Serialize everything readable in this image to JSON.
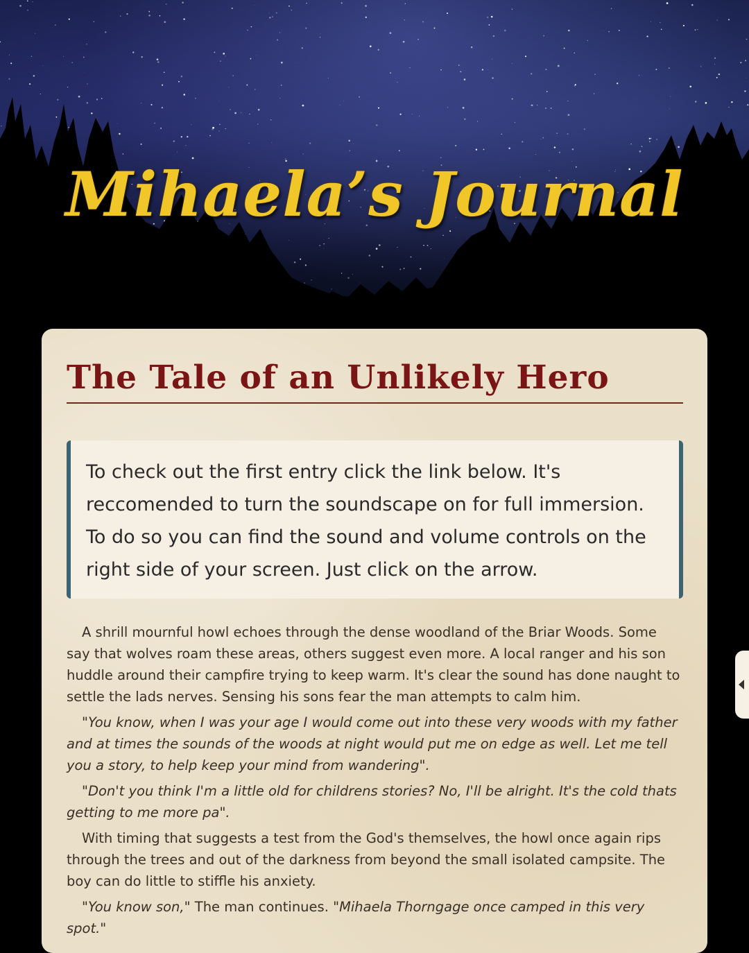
{
  "header": {
    "title": "Mihaela’s Journal"
  },
  "entry": {
    "title": "The Tale of an Unlikely Hero",
    "notice": "To check out the first entry click the link below. It's reccomended to turn the soundscape on for full immersion. To do so you can find the sound and volume controls on the right side of your screen. Just click on the arrow.",
    "paragraphs": {
      "p1": "A shrill mournful howl echoes through the dense woodland of the Briar Woods. Some say that wolves roam these areas, others suggest even more. A local ranger and his son huddle around their campfire trying to keep warm. It's clear the sound has done naught to settle the lads nerves. Sensing his sons fear the man attempts to calm him.",
      "p2": "\"You know, when I was your age I would come out into these very woods with my father and at times the sounds of the woods at night would put me on edge as well. Let me tell you a story, to help keep your mind from wandering\".",
      "p3": "\"Don't you think I'm a little old for childrens stories? No, I'll be alright. It's the cold thats getting to me more pa\".",
      "p4": "With timing that suggests a test from the God's themselves, the howl once again rips through the trees and out of the darkness from beyond the small isolated campsite. The boy can do little to stiffle his anxiety.",
      "p5a": "\"You know son,\"",
      "p5b": " The man continues. ",
      "p5c": "\"Mihaela Thorngage once camped in this very spot.\""
    }
  },
  "sound_panel": {
    "toggle_icon": "arrow-left-icon"
  },
  "colors": {
    "title_gold": "#f1c629",
    "entry_title": "#7a1515",
    "card_bg": "#eadfc8",
    "notice_border": "#3c6371"
  }
}
